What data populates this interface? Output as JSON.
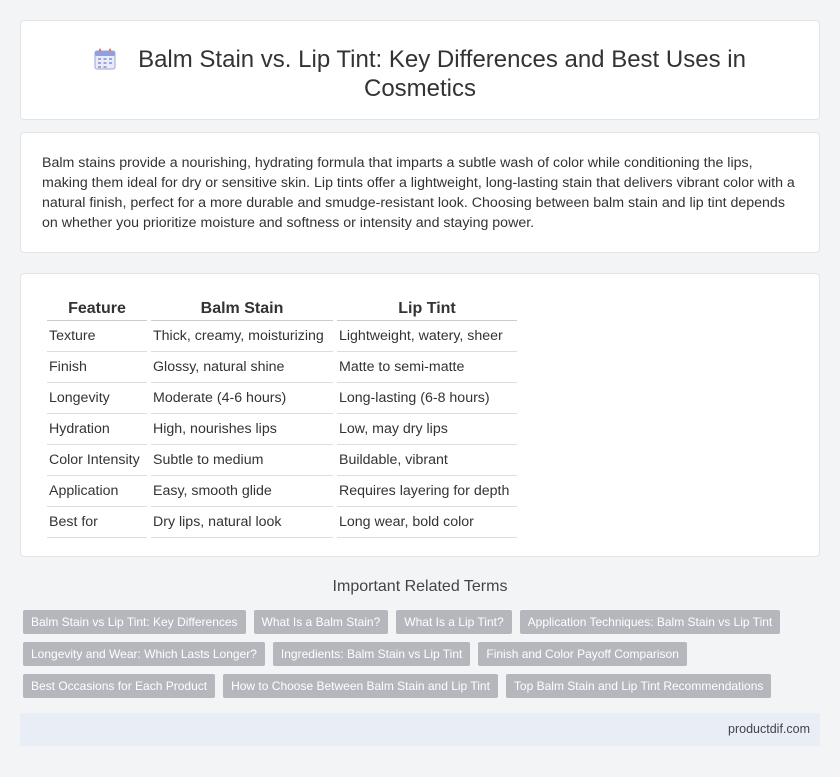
{
  "header": {
    "title": "Balm Stain vs. Lip Tint: Key Differences and Best Uses in Cosmetics",
    "icon": "calendar-icon"
  },
  "intro": {
    "text": "Balm stains provide a nourishing, hydrating formula that imparts a subtle wash of color while conditioning the lips, making them ideal for dry or sensitive skin. Lip tints offer a lightweight, long-lasting stain that delivers vibrant color with a natural finish, perfect for a more durable and smudge-resistant look. Choosing between balm stain and lip tint depends on whether you prioritize moisture and softness or intensity and staying power."
  },
  "table": {
    "headers": [
      "Feature",
      "Balm Stain",
      "Lip Tint"
    ],
    "rows": [
      [
        "Texture",
        "Thick, creamy, moisturizing",
        "Lightweight, watery, sheer"
      ],
      [
        "Finish",
        "Glossy, natural shine",
        "Matte to semi-matte"
      ],
      [
        "Longevity",
        "Moderate (4-6 hours)",
        "Long-lasting (6-8 hours)"
      ],
      [
        "Hydration",
        "High, nourishes lips",
        "Low, may dry lips"
      ],
      [
        "Color Intensity",
        "Subtle to medium",
        "Buildable, vibrant"
      ],
      [
        "Application",
        "Easy, smooth glide",
        "Requires layering for depth"
      ],
      [
        "Best for",
        "Dry lips, natural look",
        "Long wear, bold color"
      ]
    ]
  },
  "related": {
    "heading": "Important Related Terms",
    "rows": [
      [
        "Balm Stain vs Lip Tint: Key Differences",
        "What Is a Balm Stain?",
        "What Is a Lip Tint?",
        "Application Techniques: Balm Stain vs Lip Tint"
      ],
      [
        "Longevity and Wear: Which Lasts Longer?",
        "Ingredients: Balm Stain vs Lip Tint",
        "Finish and Color Payoff Comparison"
      ],
      [
        "Best Occasions for Each Product",
        "How to Choose Between Balm Stain and Lip Tint",
        "Top Balm Stain and Lip Tint Recommendations"
      ]
    ]
  },
  "footer": {
    "site": "productdif.com"
  },
  "colors": {
    "tag_bg": "#b5b7bc",
    "footer_bg": "#e8edf6",
    "page_bg": "#f3f4f6"
  }
}
